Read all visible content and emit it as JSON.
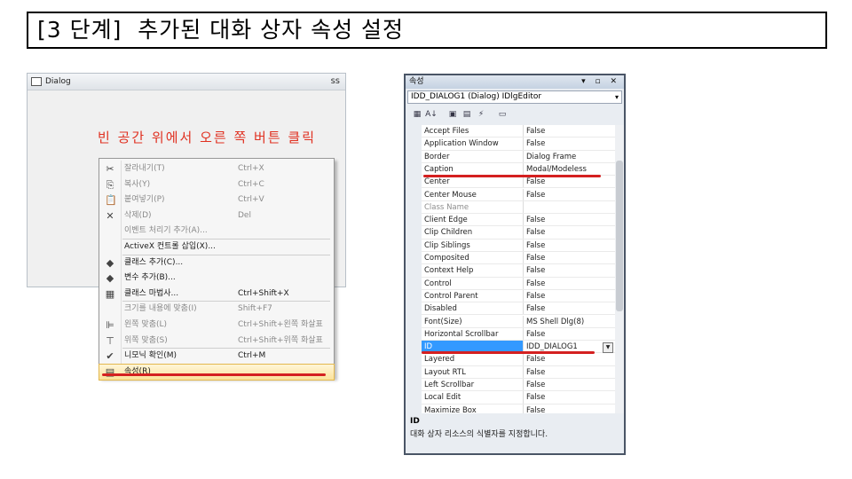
{
  "slide": {
    "title": "[3 단계]  추가된 대화 상자 속성 설정"
  },
  "dialog": {
    "title": "Dialog",
    "close": "ss"
  },
  "note": "빈 공간 위에서 오른 쪽 버튼 클릭",
  "context_menu": {
    "items": [
      {
        "icon": "scissors-icon",
        "glyph": "✂",
        "label": "잘라내기(T)",
        "shortcut": "Ctrl+X",
        "disabled": true
      },
      {
        "icon": "copy-icon",
        "glyph": "⎘",
        "label": "복사(Y)",
        "shortcut": "Ctrl+C",
        "disabled": true
      },
      {
        "icon": "paste-icon",
        "glyph": "📋",
        "label": "붙여넣기(P)",
        "shortcut": "Ctrl+V",
        "disabled": true
      },
      {
        "icon": "delete-icon",
        "glyph": "✕",
        "label": "삭제(D)",
        "shortcut": "Del",
        "disabled": true
      },
      {
        "icon": "",
        "glyph": "",
        "label": "이벤트 처리기 추가(A)...",
        "shortcut": "",
        "disabled": true
      },
      {
        "icon": "",
        "glyph": "",
        "label": "ActiveX 컨트롤 삽입(X)...",
        "shortcut": "",
        "disabled": false
      },
      {
        "icon": "add-class-icon",
        "glyph": "◆",
        "label": "클래스 추가(C)...",
        "shortcut": "",
        "disabled": false
      },
      {
        "icon": "add-variable-icon",
        "glyph": "◆",
        "label": "변수 추가(B)...",
        "shortcut": "",
        "disabled": false
      },
      {
        "icon": "class-wizard-icon",
        "glyph": "▦",
        "label": "클래스 마법사...",
        "shortcut": "Ctrl+Shift+X",
        "disabled": false
      },
      {
        "icon": "",
        "glyph": "",
        "label": "크기를 내용에 맞춤(I)",
        "shortcut": "Shift+F7",
        "disabled": true
      },
      {
        "icon": "align-left-icon",
        "glyph": "⊫",
        "label": "왼쪽 맞춤(L)",
        "shortcut": "Ctrl+Shift+왼쪽 화살표",
        "disabled": true
      },
      {
        "icon": "align-top-icon",
        "glyph": "⊤",
        "label": "위쪽 맞춤(S)",
        "shortcut": "Ctrl+Shift+위쪽 화살표",
        "disabled": true
      },
      {
        "icon": "check-mnemonic-icon",
        "glyph": "✔",
        "label": "니모닉 확인(M)",
        "shortcut": "Ctrl+M",
        "disabled": false
      },
      {
        "icon": "properties-icon",
        "glyph": "▤",
        "label": "속성(R)",
        "shortcut": "",
        "disabled": false,
        "selected": true
      }
    ]
  },
  "properties": {
    "title": "속성",
    "title_buttons": "▾ ▫ ✕",
    "object": "IDD_DIALOG1 (Dialog) IDlgEditor",
    "toolbar": [
      {
        "icon": "categorized-icon",
        "glyph": "▦"
      },
      {
        "icon": "alphabetical-icon",
        "glyph": "A↓"
      },
      {
        "icon": "properties-view-icon",
        "glyph": "▣"
      },
      {
        "icon": "events-icon",
        "glyph": "▤"
      },
      {
        "icon": "lightning-icon",
        "glyph": "⚡"
      },
      {
        "icon": "property-pages-icon",
        "glyph": "▭"
      }
    ],
    "rows": [
      {
        "name": "Accept Files",
        "value": "False"
      },
      {
        "name": "Application Window",
        "value": "False"
      },
      {
        "name": "Border",
        "value": "Dialog Frame"
      },
      {
        "name": "Caption",
        "value": "Modal/Modeless"
      },
      {
        "name": "Center",
        "value": "False"
      },
      {
        "name": "Center Mouse",
        "value": "False"
      },
      {
        "name": "Class Name",
        "value": "",
        "grey": true
      },
      {
        "name": "Client Edge",
        "value": "False"
      },
      {
        "name": "Clip Children",
        "value": "False"
      },
      {
        "name": "Clip Siblings",
        "value": "False"
      },
      {
        "name": "Composited",
        "value": "False"
      },
      {
        "name": "Context Help",
        "value": "False"
      },
      {
        "name": "Control",
        "value": "False"
      },
      {
        "name": "Control Parent",
        "value": "False"
      },
      {
        "name": "Disabled",
        "value": "False"
      },
      {
        "name": "Font(Size)",
        "value": "MS Shell Dlg(8)"
      },
      {
        "name": "Horizontal Scrollbar",
        "value": "False"
      },
      {
        "name": "ID",
        "value": "IDD_DIALOG1",
        "selected": true
      },
      {
        "name": "Layered",
        "value": "False"
      },
      {
        "name": "Layout RTL",
        "value": "False"
      },
      {
        "name": "Left Scrollbar",
        "value": "False"
      },
      {
        "name": "Local Edit",
        "value": "False"
      },
      {
        "name": "Maximize Box",
        "value": "False"
      }
    ],
    "description": {
      "title": "ID",
      "text": "대화 상자 리소스의 식별자를 지정합니다."
    }
  },
  "colors": {
    "annotation_red": "#d42020",
    "selection_blue": "#3399ff"
  }
}
